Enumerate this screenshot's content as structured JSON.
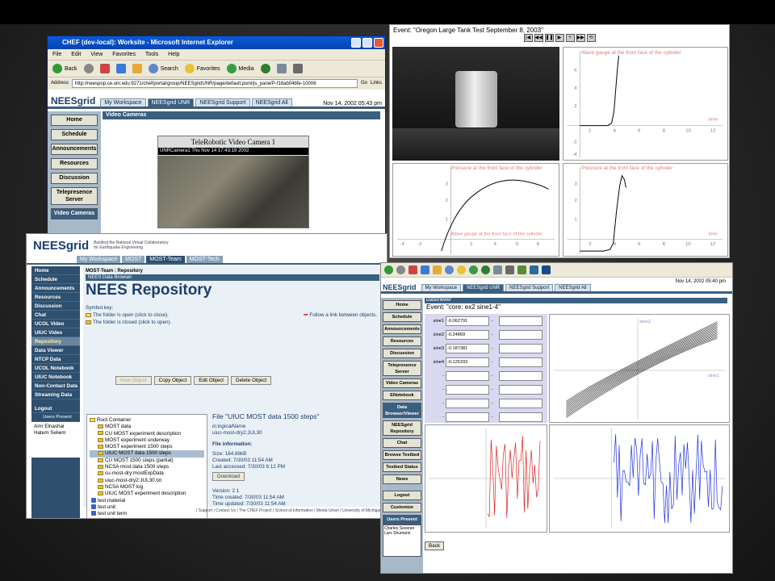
{
  "window_ie": {
    "title": "CHEF (dev-local): Worksite - Microsoft Internet Explorer",
    "menu": [
      "File",
      "Edit",
      "View",
      "Favorites",
      "Tools",
      "Help"
    ],
    "toolbar": {
      "back": "Back",
      "search": "Search",
      "favorites": "Favorites",
      "media": "Media"
    },
    "address_label": "Address",
    "address_value": "http://neespop.ce.unr.edu:9271/chef/portal/group/NEESgridUNR/page/default.psml/js_pane/P-f16ab04bfe-10006",
    "go_label": "Go",
    "links_label": "Links",
    "logo": "NEESgrid",
    "tabs": [
      "My Workspace",
      "NEESgrid UNR",
      "NEESgrid Support",
      "NEESgrid All"
    ],
    "active_tab": "NEESgrid UNR",
    "datetime": "Nov 14, 2002 05:43 pm",
    "nav": [
      "Home",
      "Schedule",
      "Announcements",
      "Resources",
      "Discussion",
      "Telepresence Server",
      "Video Cameras"
    ],
    "section_title": "Video Cameras",
    "camera_title": "TeleRobotic Video Camera 1",
    "camera_caption": "UNRCamera1  Thu Nov 14  17:43:19  2002"
  },
  "window_oregon": {
    "event_title": "Event: \"Oregon Large Tank Test September 8, 2003\"",
    "controls": [
      "|◀",
      "◀◀",
      "❚❚",
      "▶",
      "+",
      "▶▶",
      "⟲"
    ],
    "plots": [
      {
        "title": "Wave gauge at the front face of the cylinder",
        "xlabel": "time"
      },
      {
        "title": "Pressure at the front face of the cylinder",
        "xlabel": "Wave gauge at the front face of the cylinder"
      },
      {
        "title": "Pressure at the front face of the cylinder",
        "xlabel": "time"
      }
    ]
  },
  "window_repo": {
    "logo": "NEESgrid",
    "tagline_1": "Building the National Virtual Collaboratory",
    "tagline_2": "for Earthquake Engineering",
    "tabs": [
      "My Workspace",
      "MOST",
      "MOST-Team",
      "MOST-Tech"
    ],
    "active_tab": "MOST-Team",
    "nav": [
      "Home",
      "Schedule",
      "Announcements",
      "Resources",
      "Discussion",
      "Chat",
      "UCOL Video",
      "UIUC Video",
      "Repository",
      "Data Viewer",
      "NTCP Data",
      "UCOL Notebook",
      "UIUC Notebook",
      "Non-Contact Data",
      "Streaming Data",
      "Logout"
    ],
    "active_nav": "Repository",
    "users_present_label": "Users Present",
    "users": [
      "Amr Elnashai",
      "Hatem Seliem"
    ],
    "breadcrumb": "MOST-Team : Repository",
    "browser_label": "NEES Data Browser",
    "page_title": "NEES Repository",
    "symbol_key_label": "Symbol key:",
    "symbol_open": "The folder is open (click to close).",
    "symbol_closed": "The folder is closed (click to open).",
    "follow_link": "Follow a link between objects.",
    "buttons": [
      "New Object",
      "Copy Object",
      "Edit Object",
      "Delete Object"
    ],
    "tree": [
      {
        "label": "Root Container",
        "kind": "open"
      },
      {
        "label": "MOST data",
        "kind": "folder"
      },
      {
        "label": "CU MOST experiment description",
        "kind": "folder"
      },
      {
        "label": "MOST experiment underway",
        "kind": "folder"
      },
      {
        "label": "MOST experiment 1500 steps",
        "kind": "folder"
      },
      {
        "label": "UIUC MOST data 1500 steps",
        "kind": "folder",
        "selected": true
      },
      {
        "label": "CU MOST 1500 steps (partial)",
        "kind": "folder"
      },
      {
        "label": "NCSA most data 1500 steps",
        "kind": "folder"
      },
      {
        "label": "cu-most-dry:mostExpData",
        "kind": "folder"
      },
      {
        "label": "uiuc-most-dry2:JUL30.txt",
        "kind": "folder"
      },
      {
        "label": "NCSA MOST log",
        "kind": "folder"
      },
      {
        "label": "UIUC MOST experiment description",
        "kind": "folder"
      },
      {
        "label": "test material",
        "kind": "leaf"
      },
      {
        "label": "test unit",
        "kind": "leaf"
      },
      {
        "label": "test unit term",
        "kind": "leaf"
      },
      {
        "label": "test unit quant",
        "kind": "leaf"
      }
    ],
    "file": {
      "title": "File \"UIUC MOST data 1500 steps\"",
      "logical_label": "io:logicalName",
      "logical_value": "uiuc-most-dry2:JUL30",
      "info_label": "File information:",
      "size": "Size: 164.88kB",
      "created": "Created: 7/30/03 11:54 AM",
      "accessed": "Last accessed: 7/30/03 6:12 PM",
      "download": "Download",
      "version": "Version: 2 1",
      "time_created": "Time created: 7/30/03 11:54 AM",
      "time_updated": "Time updated: 7/30/03 11:54 AM"
    },
    "footer": "| Support | Contact Us | The CHEF Project | School of Information | Media Union | University of Michigan"
  },
  "window_viewer": {
    "logo": "NEESgrid",
    "tabs": [
      "My Workspace",
      "NEESgrid UNR",
      "NEESgrid Support",
      "NEESgrid All"
    ],
    "active_tab": "NEESgrid UNR",
    "datetime": "Nov 14, 2002 05:40 pm",
    "nav": [
      "Home",
      "Schedule",
      "Announcements",
      "Resources",
      "Discussion",
      "Telepresence Server",
      "Video Cameras",
      "ENotebook",
      "Data Browser/Viewer",
      "NEESgrid Repository",
      "Chat",
      "Browse Testbed",
      "Testbed Status",
      "News",
      "Logout",
      "Customize"
    ],
    "active_nav": "Data Browser/Viewer",
    "users_present_label": "Users Present",
    "users": [
      "Charles Severan",
      "Lars Shumann"
    ],
    "section": "DataViewer",
    "event_title": "Event: \"core: ex2 sine1-4\"",
    "sines": [
      {
        "label": "sine1",
        "value": "-0.062791"
      },
      {
        "label": "sine2",
        "value": "-0.24869"
      },
      {
        "label": "sine3",
        "value": "-0.187381"
      },
      {
        "label": "sine4",
        "value": "-0.125333"
      },
      {
        "label": "-",
        "value": ""
      },
      {
        "label": "-",
        "value": ""
      },
      {
        "label": "-",
        "value": ""
      },
      {
        "label": "-",
        "value": ""
      }
    ],
    "scatter_labels": {
      "y": "sine2",
      "x": "sine1"
    },
    "back": "Back"
  }
}
